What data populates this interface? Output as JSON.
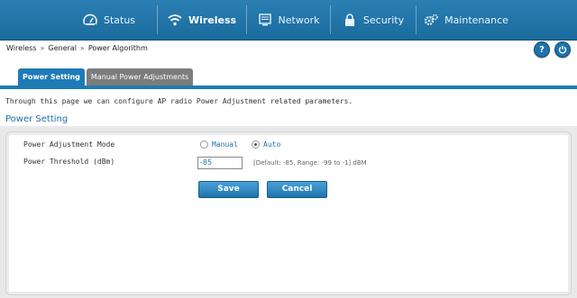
{
  "nav": {
    "status": "Status",
    "wireless": "Wireless",
    "network": "Network",
    "security": "Security",
    "maintenance": "Maintenance"
  },
  "breadcrumb": [
    "Wireless",
    "General",
    "Power Algorithm"
  ],
  "breadcrumb_sep": "»",
  "tabs": [
    "Power Setting",
    "Manual Power Adjustments"
  ],
  "description": "Through this page we can configure AP radio Power Adjustment related parameters.",
  "section_title": "Power Setting",
  "form": {
    "mode_label": "Power Adjustment Mode",
    "mode_options": [
      "Manual",
      "Auto"
    ],
    "mode_selected": "Auto",
    "threshold_label": "Power Threshold (dBm)",
    "threshold_value": "-85",
    "threshold_hint": "[Default: -85, Range: -99 to -1] dBM"
  },
  "buttons": {
    "save": "Save",
    "cancel": "Cancel"
  },
  "colors": {
    "nav_bg": "#1b6b9d",
    "accent": "#1f7bb6",
    "tab_inactive": "#7c7c7c"
  }
}
